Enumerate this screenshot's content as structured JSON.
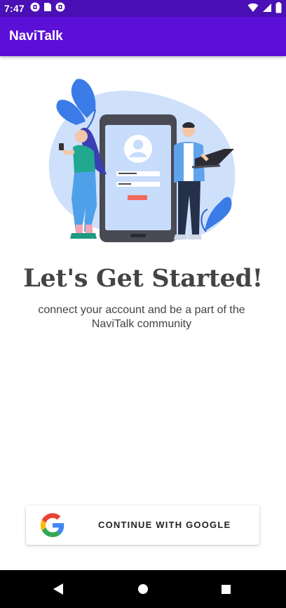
{
  "status_bar": {
    "time": "7:47",
    "left_icons": [
      "vpn-key-icon",
      "sim-card-icon",
      "vpn-key-icon"
    ],
    "right_icons": [
      "wifi-icon",
      "signal-icon",
      "battery-icon"
    ]
  },
  "app_bar": {
    "title": "NaviTalk"
  },
  "hero": {
    "illustration": "login-illustration"
  },
  "content": {
    "headline": "Let's Get Started!",
    "subtext": "connect your account and be a part of the NaviTalk community"
  },
  "google_button": {
    "label": "CONTINUE WITH GOOGLE",
    "icon": "google-icon"
  },
  "nav_bar": {
    "buttons": [
      "back-icon",
      "home-icon",
      "recents-icon"
    ]
  },
  "colors": {
    "status_bar": "#4a0fb5",
    "app_bar": "#5c0fd6",
    "text": "#444444",
    "accent_blue": "#3a7be8"
  }
}
